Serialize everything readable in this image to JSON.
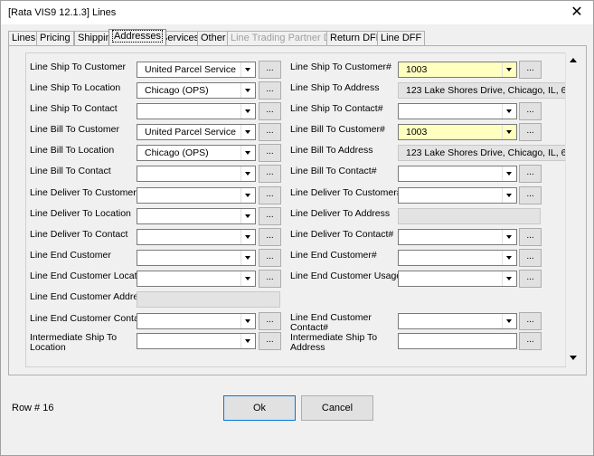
{
  "window": {
    "title": "[Rata VIS9 12.1.3] Lines",
    "close": "✕"
  },
  "tabs": [
    {
      "label": "Lines"
    },
    {
      "label": "Pricing"
    },
    {
      "label": "Shipping"
    },
    {
      "label": "Addresses"
    },
    {
      "label": "Services"
    },
    {
      "label": "Other"
    },
    {
      "label": "Line Trading Partner DFF"
    },
    {
      "label": "Return DFF"
    },
    {
      "label": "Line DFF"
    }
  ],
  "left": {
    "ship_to_customer": {
      "label": "Line Ship To Customer",
      "value": "United Parcel Service"
    },
    "ship_to_location": {
      "label": "Line Ship To Location",
      "value": "Chicago (OPS)"
    },
    "ship_to_contact": {
      "label": "Line Ship To Contact",
      "value": ""
    },
    "bill_to_customer": {
      "label": "Line Bill To Customer",
      "value": "United Parcel Service"
    },
    "bill_to_location": {
      "label": "Line Bill To Location",
      "value": "Chicago (OPS)"
    },
    "bill_to_contact": {
      "label": "Line Bill To Contact",
      "value": ""
    },
    "deliver_to_customer": {
      "label": "Line Deliver To Customer",
      "value": ""
    },
    "deliver_to_location": {
      "label": "Line Deliver To Location",
      "value": ""
    },
    "deliver_to_contact": {
      "label": "Line Deliver To Contact",
      "value": ""
    },
    "end_customer": {
      "label": "Line End Customer",
      "value": ""
    },
    "end_customer_location": {
      "label": "Line End Customer Location",
      "value": ""
    },
    "end_customer_address": {
      "label": "Line End Customer Address",
      "value": ""
    },
    "end_customer_contact": {
      "label": "Line End Customer Contact",
      "value": ""
    },
    "intermediate_ship_to_location": {
      "label_1": "Intermediate Ship To",
      "label_2": "Location",
      "value": ""
    }
  },
  "right": {
    "ship_to_customer_num": {
      "label": "Line Ship To Customer#",
      "value": "1003"
    },
    "ship_to_address": {
      "label": "Line Ship To Address",
      "value": "123 Lake Shores Drive, Chicago, IL, 6"
    },
    "ship_to_contact_num": {
      "label": "Line Ship To Contact#",
      "value": ""
    },
    "bill_to_customer_num": {
      "label": "Line Bill To Customer#",
      "value": "1003"
    },
    "bill_to_address": {
      "label": "Line Bill To Address",
      "value": "123 Lake Shores Drive, Chicago, IL, 6"
    },
    "bill_to_contact_num": {
      "label": "Line Bill To Contact#",
      "value": ""
    },
    "deliver_to_customer_num": {
      "label": "Line Deliver To Customer#",
      "value": ""
    },
    "deliver_to_address": {
      "label": "Line Deliver To Address",
      "value": ""
    },
    "deliver_to_contact_num": {
      "label": "Line Deliver To Contact#",
      "value": ""
    },
    "end_customer_num": {
      "label": "Line End Customer#",
      "value": ""
    },
    "end_customer_usage": {
      "label": "Line End Customer Usage",
      "value": ""
    },
    "end_customer_contact_num": {
      "label_1": "Line End Customer",
      "label_2": "Contact#",
      "value": ""
    },
    "intermediate_ship_to_address": {
      "label_1": "Intermediate Ship To",
      "label_2": "Address",
      "value": ""
    }
  },
  "lookup_label": "...",
  "status": {
    "row": "Row # 16"
  },
  "buttons": {
    "ok": "Ok",
    "cancel": "Cancel"
  },
  "colors": {
    "required_field": "#ffffc0",
    "readonly_field": "#e3e3e3"
  }
}
